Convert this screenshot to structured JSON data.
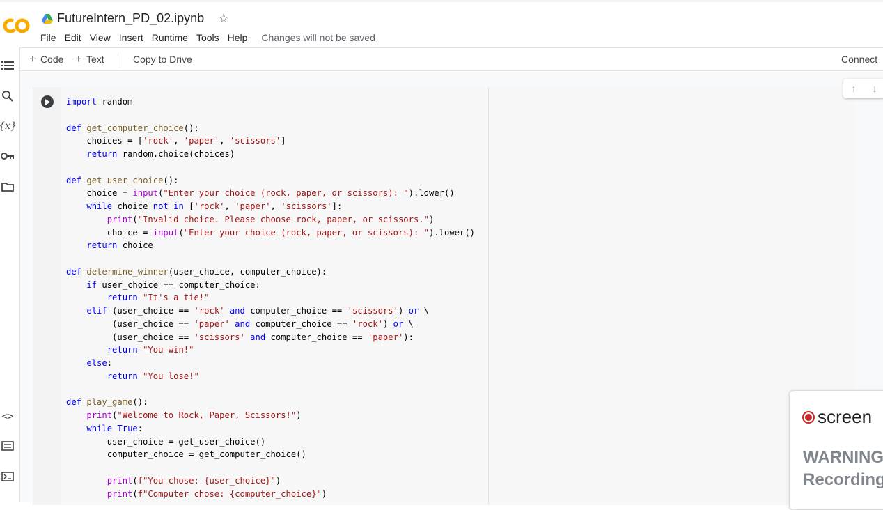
{
  "app": {
    "logo_text": "CO",
    "file_title": "FutureIntern_PD_02.ipynb"
  },
  "menu": {
    "items": [
      "File",
      "Edit",
      "View",
      "Insert",
      "Runtime",
      "Tools",
      "Help"
    ],
    "unsaved_notice": "Changes will not be saved"
  },
  "toolbar": {
    "add_code_label": "Code",
    "add_text_label": "Text",
    "copy_to_drive_label": "Copy to Drive",
    "connect_label": "Connect"
  },
  "sidebar": {
    "icons": [
      "table-of-contents-icon",
      "search-icon",
      "variables-icon",
      "secrets-key-icon",
      "files-folder-icon",
      "code-snippets-icon",
      "command-palette-icon",
      "terminal-icon"
    ]
  },
  "cell": {
    "code_lines": [
      "import random",
      "",
      "def get_computer_choice():",
      "    choices = ['rock', 'paper', 'scissors']",
      "    return random.choice(choices)",
      "",
      "def get_user_choice():",
      "    choice = input(\"Enter your choice (rock, paper, or scissors): \").lower()",
      "    while choice not in ['rock', 'paper', 'scissors']:",
      "        print(\"Invalid choice. Please choose rock, paper, or scissors.\")",
      "        choice = input(\"Enter your choice (rock, paper, or scissors): \").lower()",
      "    return choice",
      "",
      "def determine_winner(user_choice, computer_choice):",
      "    if user_choice == computer_choice:",
      "        return \"It's a tie!\"",
      "    elif (user_choice == 'rock' and computer_choice == 'scissors') or \\",
      "         (user_choice == 'paper' and computer_choice == 'rock') or \\",
      "         (user_choice == 'scissors' and computer_choice == 'paper'):",
      "        return \"You win!\"",
      "    else:",
      "        return \"You lose!\"",
      "",
      "def play_game():",
      "    print(\"Welcome to Rock, Paper, Scissors!\")",
      "    while True:",
      "        user_choice = get_user_choice()",
      "        computer_choice = get_computer_choice()",
      "",
      "        print(f\"You chose: {user_choice}\")",
      "        print(f\"Computer chose: {computer_choice}\")"
    ]
  },
  "recorder": {
    "brand": "screen",
    "warning_line1": "WARNING",
    "warning_line2": "Recording"
  },
  "colors": {
    "logo_orange": "#f9ab00",
    "keyword_blue": "#0000ff",
    "string_red": "#a31515",
    "function_brown": "#795e26",
    "record_red": "#c62828"
  }
}
